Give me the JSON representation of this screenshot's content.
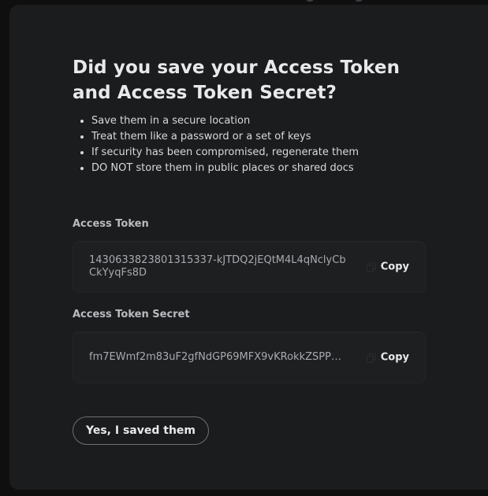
{
  "dialog": {
    "title": "Did you save your Access Token and Access Token Secret?",
    "bullets": [
      "Save them in a secure location",
      "Treat them like a password or a set of keys",
      "If security has been compromised, regenerate them",
      "DO NOT store them in public places or shared docs"
    ],
    "access_token": {
      "label": "Access Token",
      "value": "1430633823801315337-kJTDQ2jEQtM4L4qNclyCbCkYyqFs8D",
      "copy_label": "Copy"
    },
    "access_token_secret": {
      "label": "Access Token Secret",
      "value": "fm7EWmf2m83uF2gfNdGP69MFX9vKRokkZSPPx...",
      "copy_label": "Copy"
    },
    "confirm_label": "Yes, I saved them"
  },
  "icons": {
    "copy": "copy-icon"
  },
  "colors": {
    "modal_bg": "#1b1c1d",
    "field_bg": "#1e1f20",
    "text_primary": "#e7e9ea",
    "text_secondary": "#a7abb0",
    "button_border": "#6b7075"
  }
}
